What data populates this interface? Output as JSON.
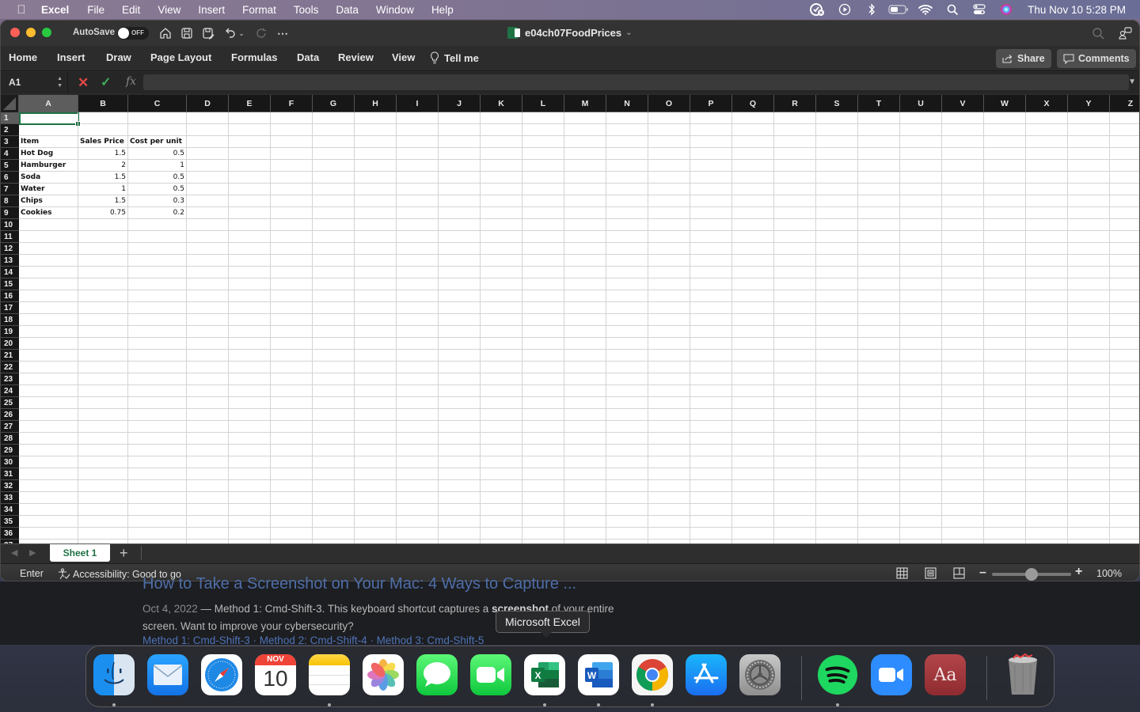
{
  "menubar": {
    "app_name": "Excel",
    "items": [
      "File",
      "Edit",
      "View",
      "Insert",
      "Format",
      "Tools",
      "Data",
      "Window",
      "Help"
    ],
    "status_icons": [
      "creative-cloud-icon",
      "play-icon",
      "bluetooth-icon",
      "battery-icon",
      "wifi-icon",
      "spotlight-search-icon",
      "control-center-icon",
      "siri-icon"
    ],
    "clock": "Thu Nov 10  5:28 PM"
  },
  "titlebar": {
    "autosave_label": "AutoSave",
    "autosave_state": "OFF",
    "document_title": "e04ch07FoodPrices"
  },
  "ribbon": {
    "tabs": [
      "Home",
      "Insert",
      "Draw",
      "Page Layout",
      "Formulas",
      "Data",
      "Review",
      "View"
    ],
    "tell_me": "Tell me",
    "share": "Share",
    "comments": "Comments"
  },
  "formula_bar": {
    "name_box": "A1",
    "fx_label": "fx",
    "formula": ""
  },
  "grid": {
    "columns": [
      "A",
      "B",
      "C",
      "D",
      "E",
      "F",
      "G",
      "H",
      "I",
      "J",
      "K",
      "L",
      "M",
      "N",
      "O",
      "P",
      "Q",
      "R",
      "S",
      "T",
      "U",
      "V",
      "W",
      "X",
      "Y",
      "Z"
    ],
    "selected_column": "A",
    "selected_row": 1,
    "visible_rows": 36,
    "active_cell": "A1",
    "table": {
      "header_row": 3,
      "headers": [
        "Item",
        "Sales Price",
        "Cost per unit"
      ],
      "rows": [
        {
          "item": "Hot Dog",
          "sales_price": "1.5",
          "cost": "0.5"
        },
        {
          "item": "Hamburger",
          "sales_price": "2",
          "cost": "1"
        },
        {
          "item": "Soda",
          "sales_price": "1.5",
          "cost": "0.5"
        },
        {
          "item": "Water",
          "sales_price": "1",
          "cost": "0.5"
        },
        {
          "item": "Chips",
          "sales_price": "1.5",
          "cost": "0.3"
        },
        {
          "item": "Cookies",
          "sales_price": "0.75",
          "cost": "0.2"
        }
      ]
    }
  },
  "sheets": {
    "tabs": [
      "Sheet 1"
    ],
    "active": "Sheet 1",
    "add_label": "+"
  },
  "statusbar": {
    "mode": "Enter",
    "accessibility": "Accessibility: Good to go",
    "zoom_percent": "100%",
    "zoom_slider_fraction": 0.5
  },
  "background_browser": {
    "result_title": "How to Take a Screenshot on Your Mac: 4 Ways to Capture ...",
    "date": "Oct 4, 2022",
    "snippet_before": " — Method 1: Cmd-Shift-3. This keyboard shortcut captures a ",
    "snippet_bold": "screenshot",
    "snippet_after": " of your entire screen. Want to improve your cybersecurity?",
    "links": "Method 1: Cmd-Shift-3 · Method 2: Cmd-Shift-4 · Method 3: Cmd-Shift-5"
  },
  "tooltip": "Microsoft Excel",
  "dock": {
    "apps": [
      {
        "name": "Finder",
        "running": true
      },
      {
        "name": "Mail",
        "running": false
      },
      {
        "name": "Safari",
        "running": false
      },
      {
        "name": "Calendar",
        "month": "NOV",
        "day": "10",
        "running": false
      },
      {
        "name": "Notes",
        "running": true
      },
      {
        "name": "Photos",
        "running": false
      },
      {
        "name": "Messages",
        "running": false
      },
      {
        "name": "FaceTime",
        "running": false
      },
      {
        "name": "Microsoft Excel",
        "label": "X",
        "running": true
      },
      {
        "name": "Microsoft Word",
        "label": "W",
        "running": true
      },
      {
        "name": "Google Chrome",
        "running": true
      },
      {
        "name": "App Store",
        "running": false
      },
      {
        "name": "System Preferences",
        "running": false
      },
      {
        "name": "Spotify",
        "running": true
      },
      {
        "name": "Zoom",
        "running": false
      },
      {
        "name": "Dictionary",
        "label": "Aa",
        "running": false
      },
      {
        "name": "Trash",
        "running": false
      }
    ]
  },
  "colors": {
    "excel_green": "#1e7145",
    "cancel_red": "#e04848",
    "confirm_green": "#3fae5a"
  }
}
